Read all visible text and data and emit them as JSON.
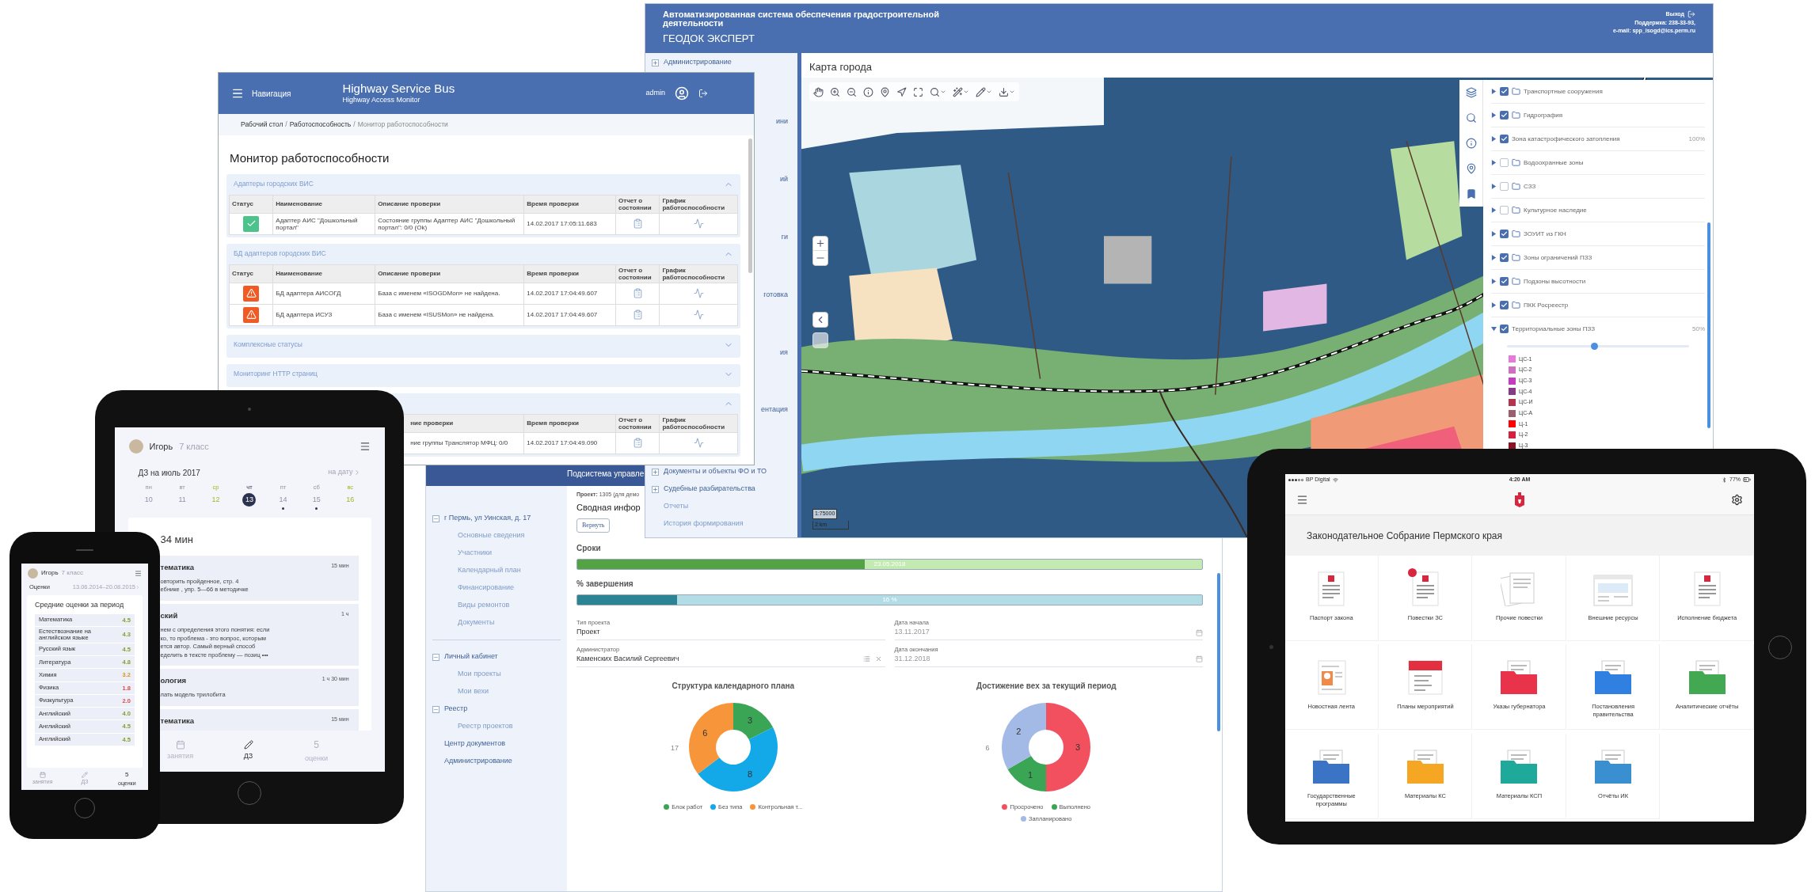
{
  "project_window": {
    "header_title": "Подсистема управле",
    "sidebar": [
      {
        "label": "г Пермь, ул Уинская, д. 17",
        "expanded": true,
        "children": [
          {
            "label": "Основные сведения"
          },
          {
            "label": "Участники"
          },
          {
            "label": "Календарный план"
          },
          {
            "label": "Финансирование"
          },
          {
            "label": "Виды ремонтов"
          },
          {
            "label": "Документы"
          }
        ]
      },
      {
        "label": "Личный кабинет",
        "expanded": true,
        "children": [
          {
            "label": "Мои проекты"
          },
          {
            "label": "Мои вехи"
          }
        ]
      },
      {
        "label": "Реестр",
        "expanded": true,
        "children": [
          {
            "label": "Реестр проектов"
          }
        ]
      },
      {
        "label": "Центр документов",
        "expanded": false
      },
      {
        "label": "Администрирование",
        "expanded": false
      }
    ],
    "project_label": "**Проект:** 1305 (для демо",
    "title": "Сводная инфор",
    "return_button": "Вернуть",
    "deadline": {
      "label": "Сроки",
      "level": 0.46,
      "reading": "23.05.2018"
    },
    "completion": {
      "label": "% завершения",
      "level": 0.16,
      "reading": "16 %"
    },
    "fields": [
      {
        "label": "Тип проекта",
        "value": "Проект",
        "kind": "text",
        "disabled": false
      },
      {
        "label": "Дата начала",
        "value": "13.11.2017",
        "kind": "date",
        "disabled": true
      },
      {
        "label": "Администратор",
        "value": "Каменских Василий Сергеевич",
        "kind": "lookup",
        "disabled": false
      },
      {
        "label": "Дата окончания",
        "value": "31.12.2018",
        "kind": "date",
        "disabled": true
      }
    ],
    "charts": [
      {
        "chart_data": {
          "type": "donut",
          "title": "Структура календарного плана",
          "data_labels": true,
          "annotations": [
            "17"
          ],
          "values": [
            3,
            8,
            6
          ]
        },
        "legend": [
          {
            "label": "Блок работ",
            "color": "#3aa655"
          },
          {
            "label": "Без типа",
            "color": "#13a8e8"
          },
          {
            "label": "Контрольная т...",
            "color": "#f7953a"
          }
        ]
      },
      {
        "chart_data": {
          "type": "donut",
          "title": "Достижение вех за текущий период",
          "data_labels": true,
          "annotations": [
            "6"
          ],
          "values": [
            3,
            1,
            2
          ]
        },
        "legend": [
          {
            "label": "Просрочено",
            "color": "#f2505f"
          },
          {
            "label": "Выполнено",
            "color": "#3aa655"
          },
          {
            "label": "Запланировано",
            "color": "#a3b9e6"
          }
        ]
      }
    ]
  },
  "gis_window": {
    "system_title": "Автоматизированная система обеспечения градостроительной деятельности",
    "product": "ГЕОДОК ЭКСПЕРТ",
    "logout": "Выход",
    "support": "Поддержка: 238-33-93,",
    "email": "e-mail: spp_isogd@ics.perm.ru",
    "sidebar_top": [
      {
        "label": "Администрирование",
        "expandable": true
      }
    ],
    "sidebar_fragments": [
      "ини",
      "ий",
      "ги",
      "готовка",
      "ия",
      "ентация"
    ],
    "sidebar_bottom": [
      {
        "label": "Документы и объекты ФО и ТО",
        "expandable": true
      },
      {
        "label": "Судебные разбирательства",
        "expandable": true
      },
      {
        "label": "Отчеты",
        "expandable": false
      },
      {
        "label": "История формирования",
        "expandable": false
      }
    ],
    "map_title": "Карта города",
    "scale": "1:75000",
    "scale_bar": "2 km",
    "layers": [
      {
        "label": "Транспортные сооружения",
        "checked": true,
        "folder": true,
        "expanded": false
      },
      {
        "label": "Гидрография",
        "checked": true,
        "folder": true,
        "expanded": false
      },
      {
        "label": "Зона катастрофического затопления",
        "checked": true,
        "folder": false,
        "expanded": false,
        "opacity": "100%"
      },
      {
        "label": "Водоохранные зоны",
        "checked": false,
        "folder": true,
        "expanded": false
      },
      {
        "label": "СЗЗ",
        "checked": false,
        "folder": true,
        "expanded": false
      },
      {
        "label": "Культурное наследие",
        "checked": false,
        "folder": true,
        "expanded": false
      },
      {
        "label": "ЗОУИТ из ГКН",
        "checked": true,
        "folder": true,
        "expanded": false
      },
      {
        "label": "Зоны ограничений ПЗЗ",
        "checked": true,
        "folder": true,
        "expanded": false
      },
      {
        "label": "Подзоны высотности",
        "checked": true,
        "folder": true,
        "expanded": false
      },
      {
        "label": "ПКК Росреестр",
        "checked": true,
        "folder": true,
        "expanded": false
      },
      {
        "label": "Территориальные зоны ПЗЗ",
        "checked": true,
        "folder": false,
        "expanded": true,
        "opacity": "50%",
        "level": 0.48,
        "legend": [
          {
            "label": "ЦС-1",
            "color": "#e47bd8"
          },
          {
            "label": "ЦС-2",
            "color": "#cf6fc0"
          },
          {
            "label": "ЦС-3",
            "color": "#c43cc0"
          },
          {
            "label": "ЦС-4",
            "color": "#873a86"
          },
          {
            "label": "ЦС-И",
            "color": "#b3344f"
          },
          {
            "label": "ЦС-А",
            "color": "#9a5f6e"
          },
          {
            "label": "Ц-1",
            "color": "#ff0000"
          },
          {
            "label": "Ц-2",
            "color": "#d4213f"
          },
          {
            "label": "Ц-3",
            "color": "#8a1424"
          }
        ]
      }
    ]
  },
  "monitor_window": {
    "nav_label": "Навигация",
    "title": "Highway Service Bus",
    "subtitle": "Highway Access Monitor",
    "user": "admin",
    "breadcrumb": [
      {
        "label": "Рабочий стол",
        "current": false
      },
      {
        "label": "Работоспособность",
        "current": false
      },
      {
        "label": "Монитор работоспособности",
        "current": true
      }
    ],
    "breadcrumb_separator": "/",
    "heading": "Монитор работоспособности",
    "sections": [
      {
        "title": "Адаптеры городских ВИС",
        "expanded": true,
        "columns": [
          "Статус",
          "Наименование",
          "Описание проверки",
          "Время проверки",
          "Отчет о состоянии",
          "График работоспособности"
        ],
        "rows": [
          {
            "kind": "ok",
            "name": "Адаптер АИС \"Дошкольный портал\"",
            "description": "Состояние группы Адаптер АИС \"Дошкольный портал\": 0/0 (Ok)",
            "time": "14.02.2017 17:05:11.683"
          }
        ]
      },
      {
        "title": "БД адаптеров городских ВИС",
        "expanded": true,
        "columns": [
          "Статус",
          "Наименование",
          "Описание проверки",
          "Время проверки",
          "Отчет о состоянии",
          "График работоспособности"
        ],
        "rows": [
          {
            "kind": "error",
            "name": "БД адаптера АИСОГД",
            "description": "База с именем «ISOGDMon» не найдена.",
            "time": "14.02.2017 17:04:49.607"
          },
          {
            "kind": "error",
            "name": "БД адаптера ИСУЗ",
            "description": "База с именем «ISUSMon» не найдена.",
            "time": "14.02.2017 17:04:49.607"
          }
        ]
      },
      {
        "title": "Комплексные статусы",
        "expanded": false
      },
      {
        "title": "Мониторинг HTTP страниц",
        "expanded": false
      },
      {
        "expanded": true,
        "columns": [
          "ние проверки",
          "Время проверки",
          "Отчет о состоянии",
          "График работоспособности"
        ],
        "rows": [
          {
            "description": "ние группы Транслятор МФЦ: 0/0",
            "time": "14.02.2017 17:04:49.090"
          }
        ]
      }
    ]
  },
  "homework_tablet": {
    "name": "Игорь",
    "grade": "7 класс",
    "heading": "ДЗ на июль 2017",
    "date_link": "на дату",
    "days": [
      {
        "weekday": "пн",
        "day": "10",
        "selected": false,
        "has_tasks": false,
        "highlighted": false
      },
      {
        "weekday": "вт",
        "day": "11",
        "selected": false,
        "has_tasks": false,
        "highlighted": false
      },
      {
        "weekday": "ср",
        "day": "12",
        "selected": false,
        "has_tasks": false,
        "highlighted": true
      },
      {
        "weekday": "чт",
        "day": "13",
        "selected": true,
        "has_tasks": false,
        "highlighted": false
      },
      {
        "weekday": "пт",
        "day": "14",
        "selected": false,
        "has_tasks": true,
        "highlighted": false
      },
      {
        "weekday": "сб",
        "day": "15",
        "selected": false,
        "has_tasks": true,
        "highlighted": false
      },
      {
        "weekday": "вс",
        "day": "16",
        "selected": false,
        "has_tasks": false,
        "highlighted": true
      }
    ],
    "total": "34 мин",
    "tasks": [
      {
        "subject": "тематика",
        "duration": "15 мин",
        "text": "овторить пройденное, стр. 4\nебнике , упр. 5—66 в методичке"
      },
      {
        "subject": "ский",
        "duration": "1 ч",
        "text": "нем с определения этого понятия: если\nко, то проблема - это вопрос, которым\nется автор. Самый верный способ\nеделить в тексте проблему — позиц •••"
      },
      {
        "subject": "ология",
        "duration": "1 ч 30 мин",
        "text": "лать модель трилобита"
      },
      {
        "subject": "тематика",
        "duration": "15 мин"
      }
    ],
    "tabs": [
      {
        "label": "занятия",
        "kind": "calendar",
        "selected": false
      },
      {
        "label": "ДЗ",
        "kind": "pencil",
        "selected": true
      },
      {
        "label": "оценки",
        "kind": "count",
        "count": "5",
        "selected": false
      }
    ]
  },
  "grades_phone": {
    "name": "Игорь",
    "grade": "7 класс",
    "section": "Оценки",
    "period": "13.06.2014–20.08.2015",
    "card_title": "Средние оценки за период",
    "subjects": [
      {
        "name": "Математика",
        "grade": "4.5",
        "kind": "good"
      },
      {
        "name": "Естествознание на английском языке",
        "grade": "4.3",
        "kind": "good"
      },
      {
        "name": "Русский язык",
        "grade": "4.5",
        "kind": "good"
      },
      {
        "name": "Литература",
        "grade": "4.8",
        "kind": "good"
      },
      {
        "name": "Химия",
        "grade": "3.2",
        "kind": "fair"
      },
      {
        "name": "Физика",
        "grade": "1.8",
        "kind": "poor"
      },
      {
        "name": "Физкультура",
        "grade": "2.0",
        "kind": "poor"
      },
      {
        "name": "Английский",
        "grade": "4.0",
        "kind": "good"
      },
      {
        "name": "Английский",
        "grade": "4.5",
        "kind": "good"
      },
      {
        "name": "Английский",
        "grade": "4.5",
        "kind": "good"
      }
    ],
    "tabs": [
      {
        "label": "занятия",
        "kind": "calendar",
        "selected": false
      },
      {
        "label": "ДЗ",
        "kind": "pencil",
        "selected": false
      },
      {
        "label": "оценки",
        "kind": "count",
        "count": "5",
        "selected": true
      }
    ]
  },
  "assembly_tablet": {
    "carrier": "BP Digital",
    "time": "4:20 AM",
    "battery": "77%",
    "title": "Законодательное Собрание Пермского края",
    "tiles": [
      {
        "label": "Паспорт закона",
        "kind": "document",
        "notified": false
      },
      {
        "label": "Повестки ЗС",
        "kind": "document",
        "notified": true
      },
      {
        "label": "Прочие повестки",
        "kind": "stack",
        "notified": false
      },
      {
        "label": "Внешние ресурсы",
        "kind": "browser",
        "notified": false
      },
      {
        "label": "Исполнение бюджета",
        "kind": "document",
        "notified": false
      },
      {
        "label": "Новостная лента",
        "kind": "profile",
        "notified": false
      },
      {
        "label": "Планы мероприятий",
        "kind": "calendar",
        "notified": false
      },
      {
        "label": "Указы губернатора",
        "kind": "folder",
        "color": "#e8334a",
        "notified": false
      },
      {
        "label": "Постановления правительства",
        "kind": "folder",
        "color": "#2f80e0",
        "notified": false
      },
      {
        "label": "Аналитические отчёты",
        "kind": "folder",
        "color": "#43a852",
        "notified": false
      },
      {
        "label": "Государственные программы",
        "kind": "folder",
        "color": "#3b74c4",
        "notified": false
      },
      {
        "label": "Материалы КС",
        "kind": "folder",
        "color": "#f5a623",
        "notified": false
      },
      {
        "label": "Материалы КСП",
        "kind": "folder",
        "color": "#1fa99a",
        "notified": false
      },
      {
        "label": "Отчёты ИК",
        "kind": "folder",
        "color": "#3a8fd0",
        "notified": false
      }
    ]
  }
}
